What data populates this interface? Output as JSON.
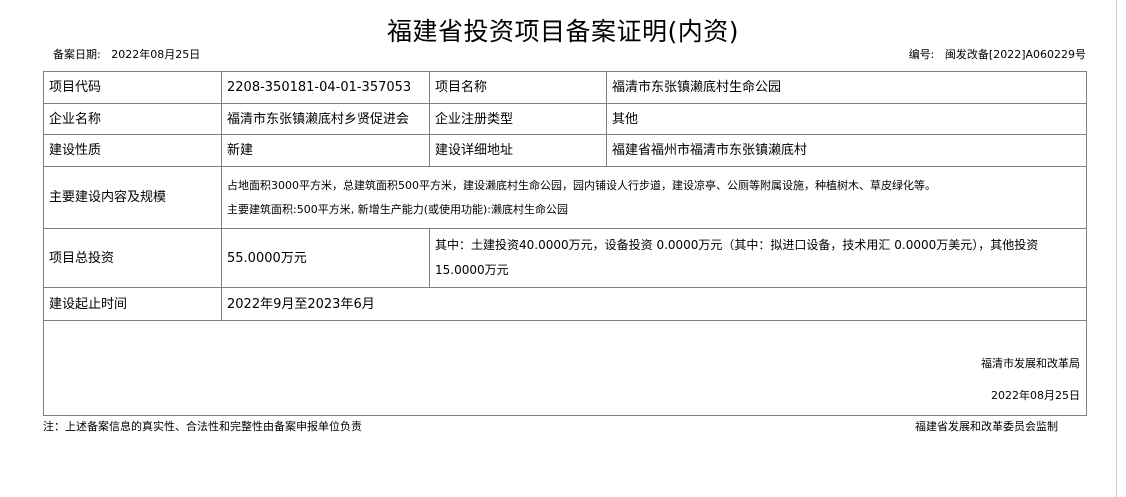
{
  "document": {
    "title": "福建省投资项目备案证明(内资)",
    "filing_date_label": "备案日期:",
    "filing_date": "2022年08月25日",
    "number_label": "编号:",
    "number": "闽发改备[2022]A060229号"
  },
  "table": {
    "project_code_label": "项目代码",
    "project_code": "2208-350181-04-01-357053",
    "project_name_label": "项目名称",
    "project_name": "福清市东张镇濑底村生命公园",
    "enterprise_name_label": "企业名称",
    "enterprise_name": "福清市东张镇濑底村乡贤促进会",
    "registration_type_label": "企业注册类型",
    "registration_type": "其他",
    "construction_nature_label": "建设性质",
    "construction_nature": "新建",
    "address_label": "建设详细地址",
    "address": "福建省福州市福清市东张镇濑底村",
    "content_label": "主要建设内容及规模",
    "content_line1": "占地面积3000平方米，总建筑面积500平方米，建设濑底村生命公园，园内铺设人行步道，建设凉亭、公厕等附属设施，种植树木、草皮绿化等。",
    "content_line2": "主要建筑面积:500平方米, 新增生产能力(或使用功能):濑底村生命公园",
    "total_investment_label": "项目总投资",
    "total_investment": "55.0000万元",
    "investment_breakdown_line1": "其中：土建投资40.0000万元，设备投资 0.0000万元（其中：拟进口设备，技术用汇 0.0000万美元），其他投资",
    "investment_breakdown_line2": "15.0000万元",
    "period_label": "建设起止时间",
    "period": "2022年9月至2023年6月"
  },
  "signature": {
    "org": "福清市发展和改革局",
    "date": "2022年08月25日"
  },
  "footer": {
    "note": "注：上述备案信息的真实性、合法性和完整性由备案申报单位负责",
    "supervisor": "福建省发展和改革委员会监制"
  }
}
